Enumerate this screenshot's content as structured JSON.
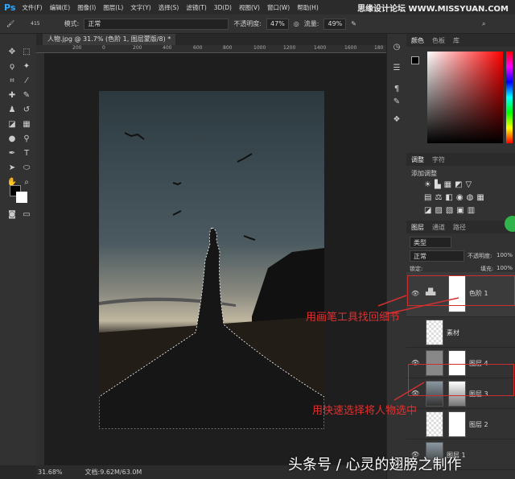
{
  "app": {
    "logo": "Ps",
    "watermark": "思缘设计论坛 WWW.MISSYUAN.COM"
  },
  "menu": [
    "文件(F)",
    "编辑(E)",
    "图像(I)",
    "图层(L)",
    "文字(Y)",
    "选择(S)",
    "滤镜(T)",
    "3D(D)",
    "视图(V)",
    "窗口(W)",
    "帮助(H)"
  ],
  "options": {
    "brush_size": "415",
    "mode_label": "模式:",
    "mode": "正常",
    "opacity_label": "不透明度:",
    "opacity": "47%",
    "flow_label": "流量:",
    "flow": "49%"
  },
  "document": {
    "tab": "人物.jpg @ 31.7% (色阶 1, 图层蒙版/8) *",
    "ruler": [
      "200",
      "0",
      "200",
      "400",
      "600",
      "800",
      "1000",
      "1200",
      "1400",
      "1600",
      "180"
    ],
    "zoom": "31.68%",
    "doc_size": "文档:9.62M/63.0M"
  },
  "color_panel": {
    "tabs": [
      "颜色",
      "色板",
      "库"
    ]
  },
  "adjust_panel": {
    "tabs": [
      "调整",
      "字符"
    ],
    "title": "添加调整"
  },
  "layers_panel": {
    "tabs": [
      "图层",
      "通道",
      "路径"
    ],
    "filter": "类型",
    "blend": "正常",
    "opacity_label": "不透明度:",
    "opacity": "100%",
    "lock_label": "锁定:",
    "fill_label": "填充:",
    "fill": "100%",
    "layers": [
      "色阶 1",
      "素材",
      "图层 4",
      "图层 3",
      "图层 2",
      "图层 1"
    ]
  },
  "annotations": [
    "用画笔工具找回细节",
    "用快速选择将人物选中"
  ],
  "caption": "头条号 / 心灵的翅膀之制作"
}
